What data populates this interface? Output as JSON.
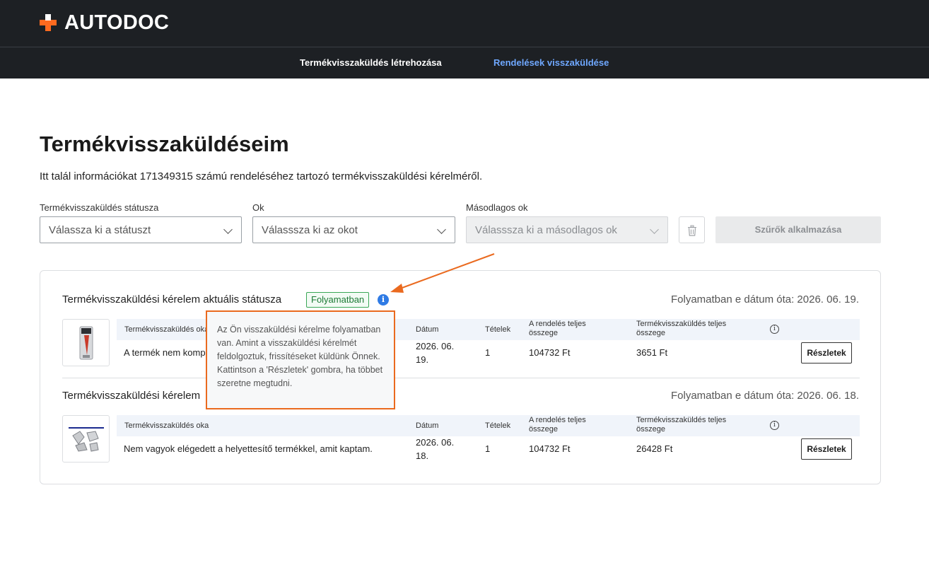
{
  "brand": {
    "name": "AUTODOC",
    "accent": "#ff6a1f"
  },
  "nav": {
    "create_return": "Termékvisszaküldés létrehozása",
    "order_returns": "Rendelések visszaküldése"
  },
  "page": {
    "title": "Termékvisszaküldéseim",
    "intro": "Itt talál információkat 171349315 számú rendeléséhez tartozó termékvisszaküldési kérelméről."
  },
  "filters": {
    "status": {
      "label": "Termékvisszaküldés státusza",
      "placeholder": "Válassza ki a státuszt"
    },
    "reason": {
      "label": "Ok",
      "placeholder": "Válasssza ki az okot"
    },
    "secondary": {
      "label": "Másodlagos ok",
      "placeholder": "Válasssza ki a másodlagos ok"
    },
    "clear_icon": "trash-icon",
    "apply": "Szűrők alkalmazása"
  },
  "table_headers": {
    "reason": "Termékvisszaküldés oka",
    "date": "Dátum",
    "items": "Tételek",
    "order_total_1": "A rendelés teljes",
    "order_total_2": "összege",
    "return_total_1": "Termékvisszaküldés teljes",
    "return_total_2": "összege"
  },
  "returns": [
    {
      "status_label": "Termékvisszaküldési kérelem aktuális státusza",
      "status_badge": "Folyamatban",
      "since": "Folyamatban e dátum óta: 2026. 06. 19.",
      "reason": "A termék nem komp",
      "date_1": "2026. 06.",
      "date_2": "19.",
      "items": "1",
      "order_total": "104732 Ft",
      "return_total": "3651 Ft",
      "details": "Részletek"
    },
    {
      "status_label": "Termékvisszaküldési kérelem",
      "since": "Folyamatban e dátum óta: 2026. 06. 18.",
      "reason": "Nem vagyok elégedett a helyettesítő termékkel, amit kaptam.",
      "date_1": "2026. 06.",
      "date_2": "18.",
      "items": "1",
      "order_total": "104732 Ft",
      "return_total": "26428 Ft",
      "details": "Részletek"
    }
  ],
  "tooltip": {
    "text": "Az Ön visszaküldési kérelme folyamatban van. Amint a visszaküldési kérelmét feldolgoztuk, frissítéseket küldünk Önnek. Kattintson a 'Részletek' gombra, ha többet szeretne megtudni."
  },
  "colors": {
    "annotation": "#ea6a1f",
    "info": "#2f7be5",
    "status_ok": "#3aa756"
  }
}
